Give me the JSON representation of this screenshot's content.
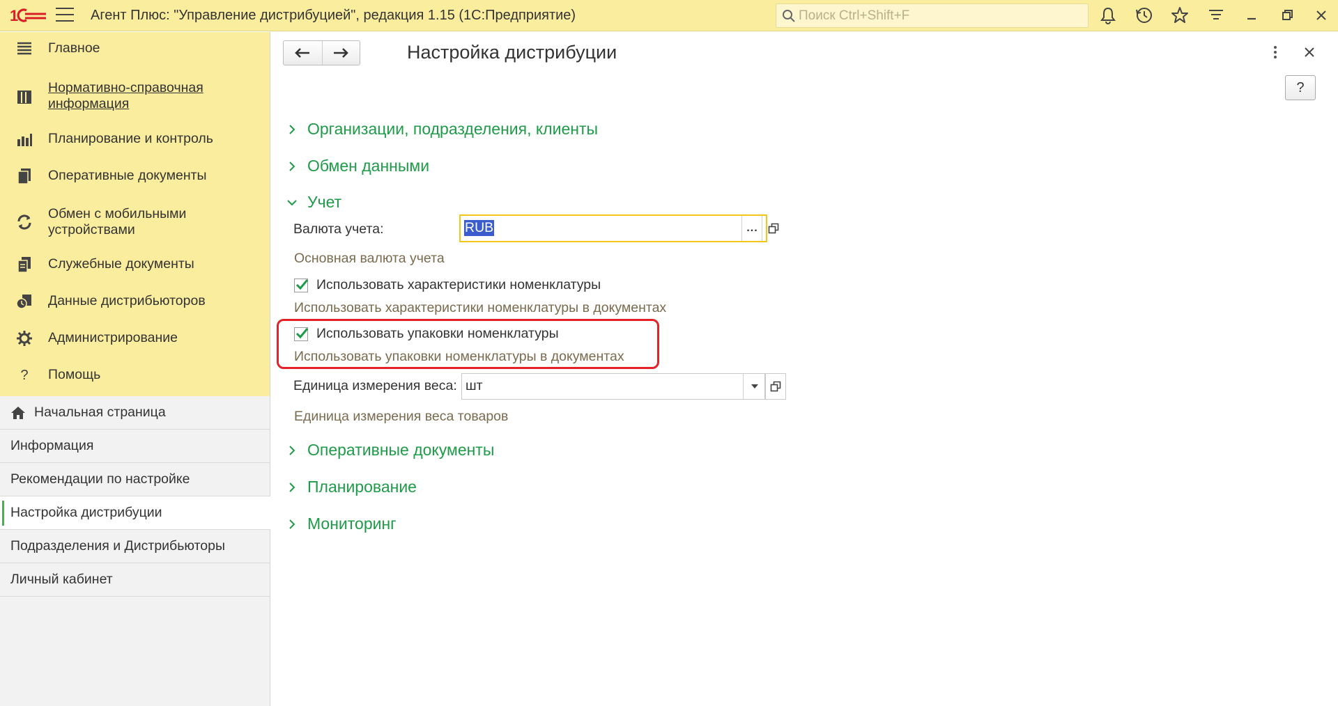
{
  "titlebar": {
    "logo_text": "1С",
    "title": "Агент Плюс: \"Управление дистрибуцией\", редакция 1.15  (1С:Предприятие)",
    "search_placeholder": "Поиск Ctrl+Shift+F",
    "icons": [
      "bell-icon",
      "history-icon",
      "star-icon",
      "menu-lines-icon",
      "minimize-icon",
      "restore-icon",
      "close-icon"
    ]
  },
  "sidebar": {
    "sections": [
      {
        "label": "Главное",
        "icon": "list-icon"
      },
      {
        "label": "Нормативно-справочная информация",
        "icon": "catalog-icon"
      },
      {
        "label": "Планирование и контроль",
        "icon": "chart-icon"
      },
      {
        "label": "Оперативные документы",
        "icon": "documents-icon"
      },
      {
        "label": "Обмен с мобильными устройствами",
        "icon": "sync-icon"
      },
      {
        "label": "Служебные документы",
        "icon": "service-docs-icon"
      },
      {
        "label": "Данные дистрибьюторов",
        "icon": "distributor-data-icon"
      },
      {
        "label": "Администрирование",
        "icon": "gear-icon"
      },
      {
        "label": "Помощь",
        "icon": "question-icon"
      }
    ],
    "open_windows": [
      {
        "label": "Начальная страница"
      },
      {
        "label": "Информация"
      },
      {
        "label": "Рекомендации по настройке"
      },
      {
        "label": "Настройка дистрибуции"
      },
      {
        "label": "Подразделения и Дистрибьюторы"
      },
      {
        "label": "Личный кабинет"
      }
    ],
    "active_window": "Настройка дистрибуции"
  },
  "form": {
    "title": "Настройка дистрибуции",
    "help_label": "?",
    "groups": {
      "org": "Организации, подразделения, клиенты",
      "exchange": "Обмен данными",
      "accounting": "Учет",
      "operational": "Оперативные документы",
      "planning": "Планирование",
      "monitoring": "Мониторинг"
    },
    "currency": {
      "label": "Валюта учета:",
      "value": "RUB",
      "choice_btn": "...",
      "hint": "Основная валюта учета"
    },
    "use_characteristics": {
      "label": "Использовать характеристики номенклатуры",
      "checked": true,
      "hint": "Использовать характеристики номенклатуры в документах"
    },
    "use_packages": {
      "label": "Использовать упаковки номенклатуры",
      "checked": true,
      "hint": "Использовать упаковки номенклатуры в документах"
    },
    "weight_unit": {
      "label": "Единица измерения веса:",
      "value": "шт",
      "hint": "Единица измерения веса товаров"
    }
  },
  "colors": {
    "titlebar_bg": "#fbed9e",
    "group_green": "#1e9b48",
    "hint_brown": "#7a6b4f",
    "highlight_red": "#e32127",
    "selection_blue": "#3b5ccc"
  }
}
